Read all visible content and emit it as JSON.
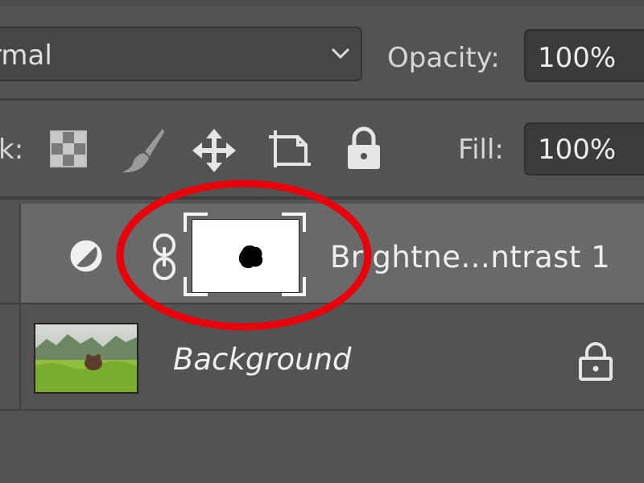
{
  "blend_mode": {
    "value": "Normal",
    "visible_text": "rmal"
  },
  "opacity": {
    "label": "Opacity:",
    "value": "100%"
  },
  "lock": {
    "label_visible": "k:"
  },
  "fill": {
    "label": "Fill:",
    "value": "100%"
  },
  "layers": [
    {
      "name": "Brightne...ntrast 1",
      "type": "adjustment",
      "selected": true
    },
    {
      "name": "Background",
      "type": "pixel",
      "locked": true
    }
  ],
  "icons": {
    "blend_chevron": "chevron-down-icon",
    "lock_transparent": "checkerboard-icon",
    "lock_image": "brush-icon",
    "lock_position": "move-arrows-icon",
    "lock_artboard": "artboard-icon",
    "lock_all": "lock-icon",
    "adjustment": "half-circle-icon",
    "link": "chain-link-icon",
    "bg_lock": "lock-outline-icon"
  },
  "colors": {
    "panel": "#535353",
    "selected_row": "#696969",
    "annotation": "#e8000b"
  }
}
